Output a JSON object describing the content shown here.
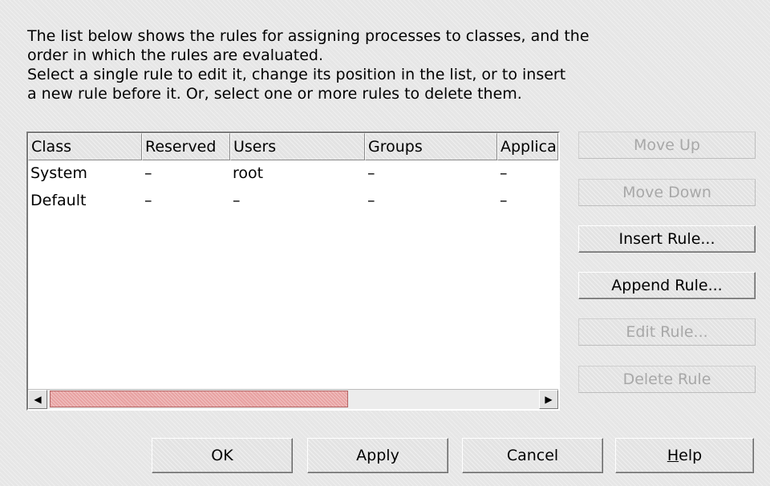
{
  "description": {
    "lines": [
      "The list below shows the rules for assigning processes to classes, and the",
      "order in which the rules are evaluated.",
      "Select a single rule to edit it, change its position in the list, or to insert",
      "a new rule before it. Or, select one or more rules to delete them."
    ]
  },
  "table": {
    "columns": [
      "Class",
      "Reserved",
      "Users",
      "Groups",
      "Applica"
    ],
    "rows": [
      [
        "System",
        "–",
        "root",
        "–",
        "–"
      ],
      [
        "Default",
        "–",
        "–",
        "–",
        "–"
      ]
    ],
    "scroll_left_icon": "arrow-left-icon",
    "scroll_right_icon": "arrow-right-icon"
  },
  "side_buttons": {
    "move_up": "Move Up",
    "move_down": "Move Down",
    "insert_rule": "Insert Rule...",
    "append_rule": "Append Rule...",
    "edit_rule": "Edit Rule...",
    "delete_rule": "Delete Rule"
  },
  "bottom_buttons": {
    "ok": "OK",
    "apply": "Apply",
    "cancel": "Cancel",
    "help_mnemonic": "H",
    "help_rest": "elp"
  },
  "colors": {
    "background": "#e6e6e6",
    "scrollbar_thumb": "#e8a2a2",
    "disabled_text": "#a8a8a8"
  }
}
